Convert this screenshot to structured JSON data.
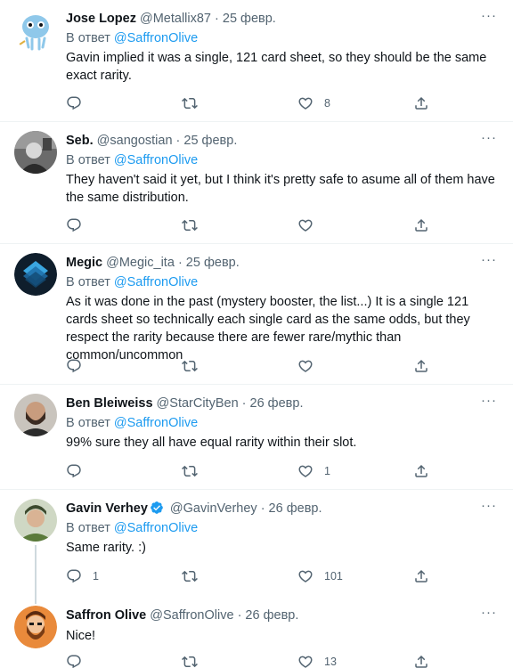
{
  "more_label": "···",
  "reply_prefix": "В ответ",
  "tweets": [
    {
      "name": "Jose Lopez",
      "handle": "@Metallix87",
      "date": "· 25 февр.",
      "reply_to": "@SaffronOlive",
      "text": "Gavin implied it was a single, 121 card sheet, so they should be the same exact rarity.",
      "replies": "",
      "retweets": "",
      "likes": "8"
    },
    {
      "name": "Seb.",
      "handle": "@sangostian",
      "date": "· 25 февр.",
      "reply_to": "@SaffronOlive",
      "text": "They haven't said it yet, but I think it's pretty safe to asume all of them have the same distribution.",
      "replies": "",
      "retweets": "",
      "likes": ""
    },
    {
      "name": "Megic",
      "handle": "@Megic_ita",
      "date": "· 25 февр.",
      "reply_to": "@SaffronOlive",
      "text": "As it was done in the past (mystery booster, the list...) It is a single 121 cards sheet so technically each single card as the same odds, but they respect the rarity because there are fewer rare/mythic than common/uncommon",
      "replies": "",
      "retweets": "",
      "likes": ""
    },
    {
      "name": "Ben Bleiweiss",
      "handle": "@StarCityBen",
      "date": "· 26 февр.",
      "reply_to": "@SaffronOlive",
      "text": "99% sure they all have equal rarity within their slot.",
      "replies": "",
      "retweets": "",
      "likes": "1"
    },
    {
      "name": "Gavin Verhey",
      "handle": "@GavinVerhey",
      "date": "· 26 февр.",
      "reply_to": "@SaffronOlive",
      "text": "Same rarity. :)",
      "replies": "1",
      "retweets": "",
      "likes": "101",
      "verified": true
    },
    {
      "name": "Saffron Olive",
      "handle": "@SaffronOlive",
      "date": "· 26 февр.",
      "reply_to": "",
      "text": "Nice!",
      "replies": "",
      "retweets": "",
      "likes": "13"
    }
  ],
  "colors": {
    "primary_text": "#0f1419",
    "secondary_text": "#536471",
    "link": "#1d9bf0",
    "divider": "#eff3f4"
  }
}
